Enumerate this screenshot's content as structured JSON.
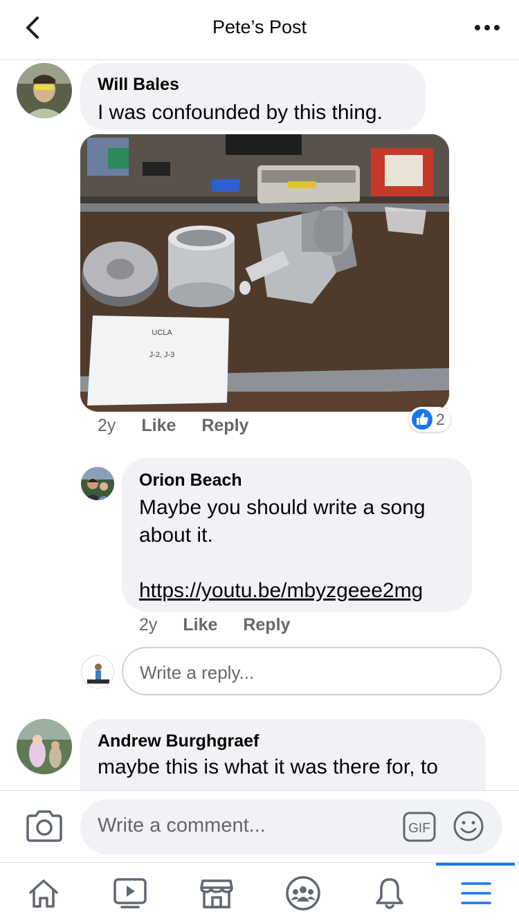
{
  "header": {
    "title": "Pete’s Post",
    "back_icon": "chevron-left-icon",
    "more_icon": "more-icon"
  },
  "comments": [
    {
      "author": "Will Bales",
      "text": "I was confounded by this thing.",
      "photo": {
        "sign_line1": "UCLA",
        "sign_line2": "J-2, J-3"
      },
      "time": "2y",
      "like_label": "Like",
      "reply_label": "Reply",
      "reaction_count": "2"
    },
    {
      "author": "Orion Beach",
      "text_line1": "Maybe you should write a song",
      "text_line2": "about it.",
      "link": "https://youtu.be/mbyzgeee2mg",
      "time": "2y",
      "like_label": "Like",
      "reply_label": "Reply"
    },
    {
      "author": "Andrew Burghgraef",
      "text": "maybe this is what it was there for, to"
    }
  ],
  "reply_input": {
    "placeholder": "Write a reply..."
  },
  "composer": {
    "placeholder": "Write a comment...",
    "gif_label": "GIF"
  },
  "nav": [
    {
      "name": "home",
      "icon": "home-icon"
    },
    {
      "name": "watch",
      "icon": "video-icon"
    },
    {
      "name": "marketplace",
      "icon": "marketplace-icon"
    },
    {
      "name": "groups",
      "icon": "groups-icon"
    },
    {
      "name": "notifications",
      "icon": "bell-icon"
    },
    {
      "name": "menu",
      "icon": "menu-icon",
      "active": true
    }
  ],
  "colors": {
    "accent": "#1877f2",
    "bubble": "#f0f2f5",
    "secondary_text": "#65676b"
  }
}
